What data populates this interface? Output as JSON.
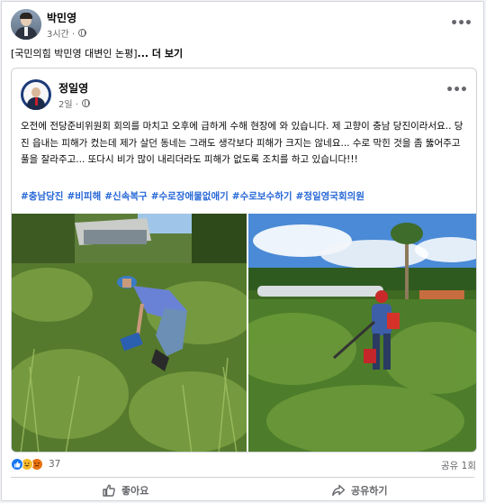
{
  "post": {
    "author": "박민영",
    "time": "3시간 ·",
    "text_prefix": "[국민의힘 박민영 대변인 논평]",
    "see_more": "... 더 보기"
  },
  "shared": {
    "author": "정일영",
    "time": "2일 ·",
    "body": "오전에 전당준비위원회 회의를 마치고 오후에 급하게 수해 현장에 와 있습니다. 제 고향이 충남 당진이라서요.. 당진 읍내는 피해가 컸는데 제가 살던 동네는 그래도 생각보다 피해가 크지는 않네요... 수로 막힌 것을 좀 뚫어주고 풀을 잘라주고... 또다시 비가 많이 내리더라도 피해가 없도록 조치를 하고 있습니다!!!",
    "hashtags": [
      "#충남당진",
      "#비피해",
      "#신속복구",
      "#수로장애물없애기",
      "#수로보수하기",
      "#정일영국회의원"
    ]
  },
  "footer": {
    "reaction_count": "37",
    "share_count": "공유 1회",
    "like_label": "좋아요",
    "share_label": "공유하기"
  },
  "colors": {
    "hashtag": "#2566d6",
    "like_blue": "#1877f2",
    "muted_text": "#65676b"
  }
}
